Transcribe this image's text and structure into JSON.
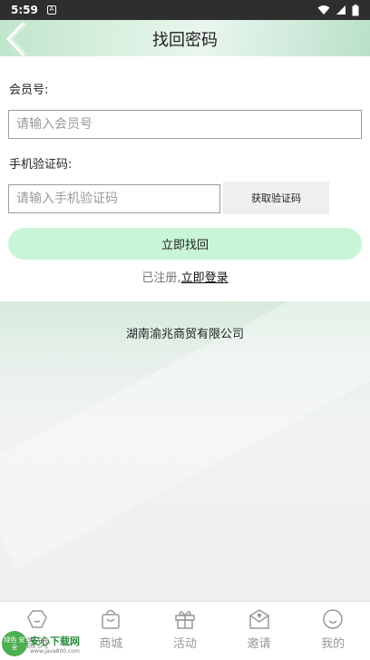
{
  "status_bar": {
    "time": "5:59",
    "notification_icon": "A"
  },
  "header": {
    "title": "找回密码"
  },
  "form": {
    "member_label": "会员号:",
    "member_placeholder": "请输入会员号",
    "code_label": "手机验证码:",
    "code_placeholder": "请输入手机验证码",
    "get_code_button": "获取验证码",
    "submit_button": "立即找回",
    "registered_text": "已注册,",
    "login_link": "立即登录"
  },
  "footer": {
    "company": "湖南渝兆商贸有限公司"
  },
  "tabbar": {
    "items": [
      {
        "label": "首页",
        "icon": "home-icon"
      },
      {
        "label": "商城",
        "icon": "bag-icon"
      },
      {
        "label": "活动",
        "icon": "gift-icon"
      },
      {
        "label": "邀请",
        "icon": "mail-icon"
      },
      {
        "label": "我的",
        "icon": "smile-icon"
      }
    ]
  },
  "watermark": {
    "logo_text": "绿色 安全",
    "name": "安心下载网",
    "url": "www.java800.com"
  },
  "colors": {
    "header_green": "#cfeadb",
    "button_green": "#c9f5d7",
    "status_bar": "#2e2e2e"
  }
}
